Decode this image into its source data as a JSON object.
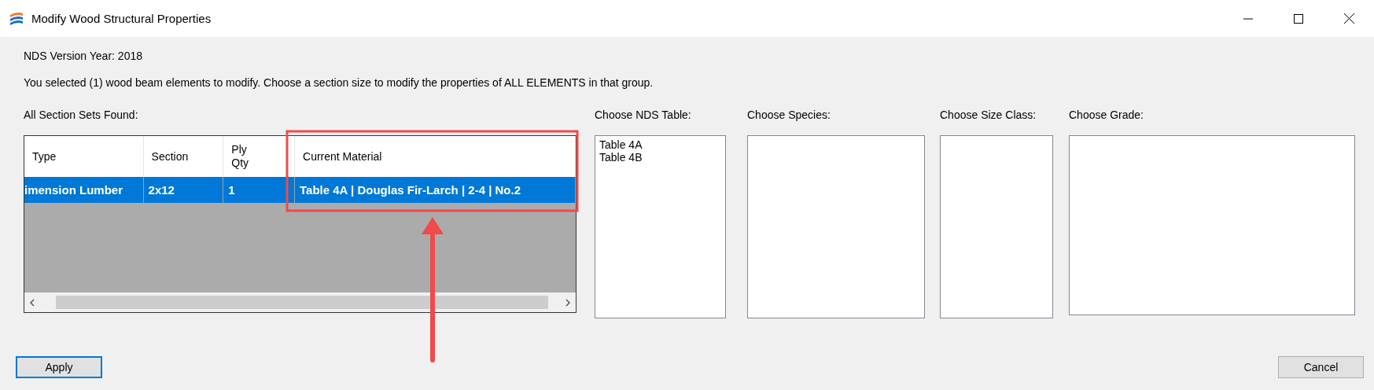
{
  "window": {
    "title": "Modify Wood Structural Properties"
  },
  "version_label": "NDS Version Year: 2018",
  "instructions": "You selected (1) wood beam elements to modify. Choose a section size to modify the properties of ALL ELEMENTS in that group.",
  "section_sets": {
    "label": "All Section Sets Found:",
    "columns": [
      "Type",
      "Section",
      "Ply Qty",
      "Current Material"
    ],
    "rows": [
      {
        "cells": [
          "imension Lumber",
          "2x12",
          "1",
          "Table 4A | Douglas Fir-Larch | 2-4 | No.2"
        ],
        "selected": true
      }
    ]
  },
  "pickers": [
    {
      "label": "Choose NDS Table:",
      "items": [
        {
          "text": "Table 4A",
          "selected": false
        },
        {
          "text": "Table 4B",
          "selected": false
        }
      ]
    },
    {
      "label": "Choose Species:"
    },
    {
      "label": "Choose Size Class:"
    },
    {
      "label": "Choose Grade:"
    }
  ],
  "buttons": [
    {
      "label": "Apply",
      "focused": true
    },
    {
      "label": "Cancel",
      "focused": false
    }
  ]
}
